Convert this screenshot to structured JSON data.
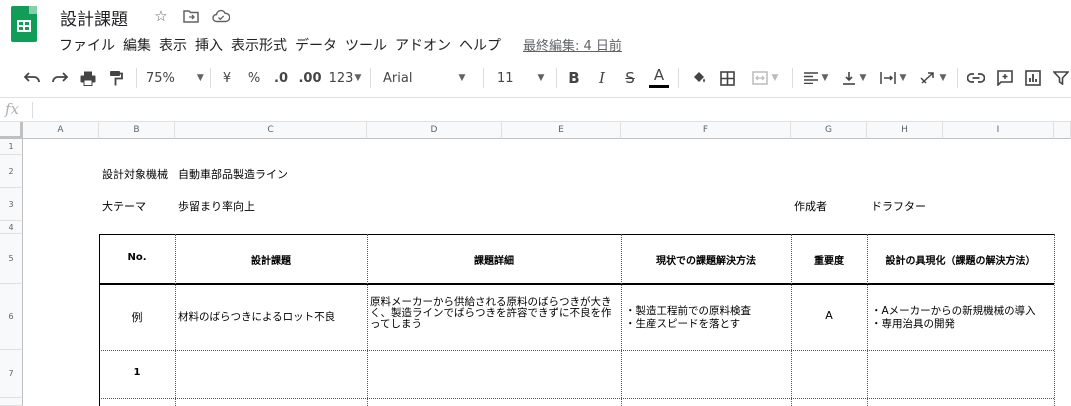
{
  "app": {
    "doc_title": "設計課題",
    "menu": [
      "ファイル",
      "編集",
      "表示",
      "挿入",
      "表示形式",
      "データ",
      "ツール",
      "アドオン",
      "ヘルプ"
    ],
    "last_edit": "最終編集: 4 日前"
  },
  "toolbar": {
    "zoom": "75%",
    "currency": "¥",
    "percent": "%",
    "decrease_decimal": ".0",
    "increase_decimal": ".00",
    "number_format": "123",
    "font": "Arial",
    "font_size": "11",
    "bold": "B",
    "italic": "I",
    "strike": "S",
    "text_color": "A"
  },
  "formula_bar": {
    "fx": "fx",
    "value": ""
  },
  "columns": [
    "A",
    "B",
    "C",
    "D",
    "E",
    "F",
    "G",
    "H",
    "I"
  ],
  "rows": [
    "1",
    "2",
    "3",
    "4",
    "5",
    "6",
    "7"
  ],
  "sheet": {
    "design_target_label": "設計対象機械",
    "design_target_value": "自動車部品製造ライン",
    "theme_label": "大テーマ",
    "theme_value": "歩留まり率向上",
    "author_label": "作成者",
    "author_value": "ドラフター",
    "table_headers": {
      "no": "No.",
      "issue": "設計課題",
      "detail": "課題詳細",
      "current": "現状での課題解決方法",
      "priority": "重要度",
      "solution": "設計の具現化（課題の解決方法）"
    },
    "example_row": {
      "no": "例",
      "issue": "材料のばらつきによるロット不良",
      "detail": "原料メーカーから供給される原料のばらつきが大きく、製造ラインでばらつきを許容できずに不良を作ってしまう",
      "current_1": "・製造工程前での原料検査",
      "current_2": "・生産スピードを落とす",
      "priority": "A",
      "solution_1": "・Aメーカーからの新規機械の導入",
      "solution_2": "・専用治具の開発"
    },
    "row1_no": "1"
  },
  "colors": {
    "brand": "#0f9d58",
    "grid_header": "#f8f9fa",
    "grid_line": "#e0e0e0"
  }
}
